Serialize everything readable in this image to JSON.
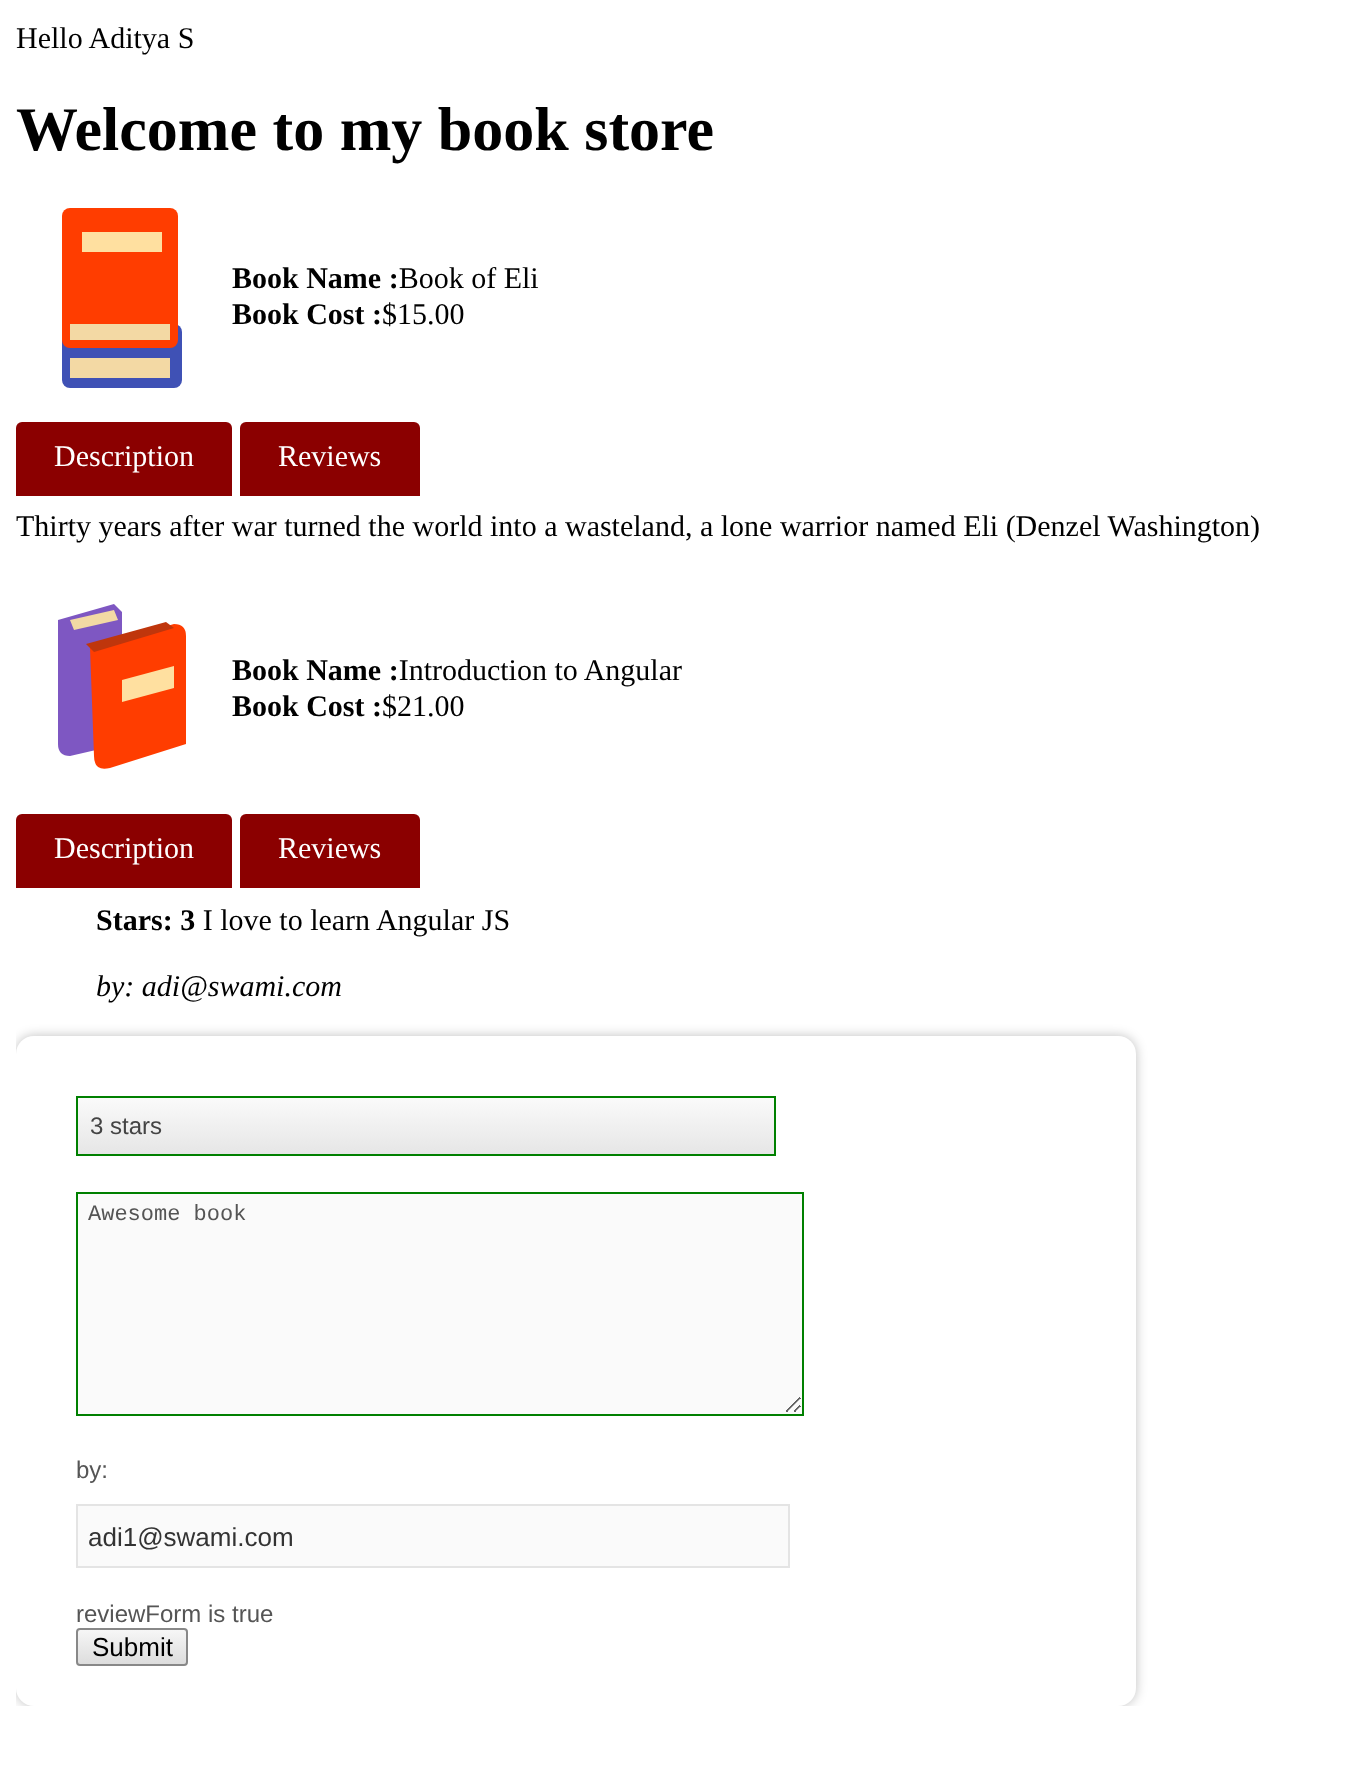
{
  "greeting": "Hello Aditya S",
  "heading": "Welcome to my book store",
  "books": [
    {
      "name_label": "Book Name :",
      "name": "Book of Eli",
      "cost_label": "Book Cost :",
      "cost": "$15.00",
      "tabs": [
        "Description",
        "Reviews"
      ],
      "description": "Thirty years after war turned the world into a wasteland, a lone warrior named Eli (Denzel Washington)"
    },
    {
      "name_label": "Book Name :",
      "name": "Introduction to Angular",
      "cost_label": "Book Cost :",
      "cost": "$21.00",
      "tabs": [
        "Description",
        "Reviews"
      ],
      "reviews": [
        {
          "stars_label": "Stars: 3",
          "body": "I love to learn Angular JS",
          "author": "by: adi@swami.com"
        }
      ]
    }
  ],
  "review_form": {
    "stars_value": "3 stars",
    "comment_value": "Awesome book",
    "author_label": "by:",
    "author_value": "adi1@swami.com",
    "status": "reviewForm is true",
    "submit": "Submit"
  }
}
